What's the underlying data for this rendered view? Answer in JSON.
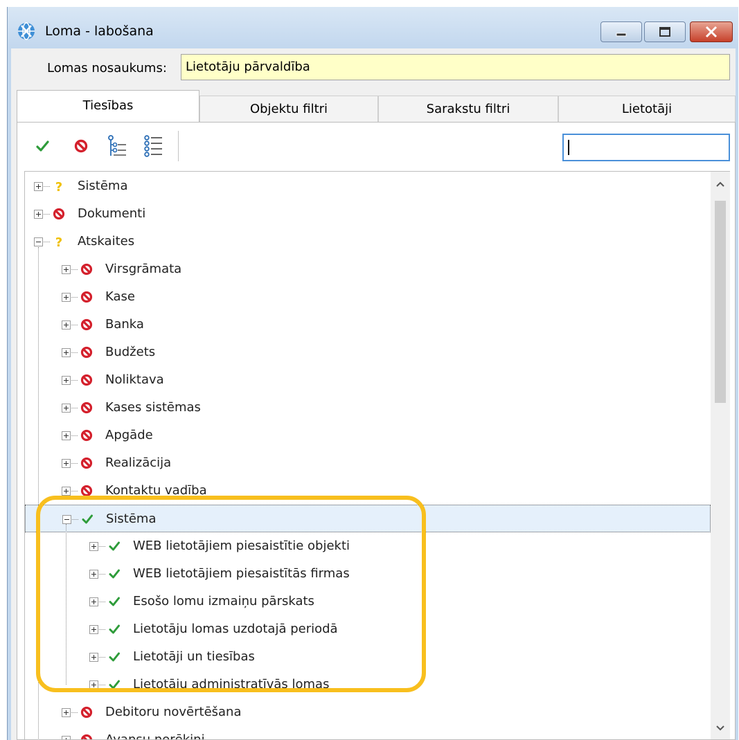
{
  "window": {
    "title": "Loma - labošana",
    "icons": {
      "app": "globe-icon",
      "minimize": "minimize-icon",
      "maximize": "maximize-icon",
      "close": "close-icon"
    }
  },
  "form": {
    "name_label": "Lomas nosaukums:",
    "name_value": "Lietotāju pārvaldība"
  },
  "tabs": [
    {
      "label": "Tiesības",
      "active": true
    },
    {
      "label": "Objektu filtri",
      "active": false
    },
    {
      "label": "Sarakstu filtri",
      "active": false
    },
    {
      "label": "Lietotāji",
      "active": false
    }
  ],
  "toolbar": {
    "buttons": [
      "allow-all-icon",
      "deny-all-icon",
      "expand-tree-icon",
      "collapse-list-icon"
    ],
    "search_value": ""
  },
  "tree": [
    {
      "label": "Sistēma",
      "status": "partial",
      "expanded": false
    },
    {
      "label": "Dokumenti",
      "status": "deny",
      "expanded": false
    },
    {
      "label": "Atskaites",
      "status": "partial",
      "expanded": true,
      "children": [
        {
          "label": "Virsgrāmata",
          "status": "deny",
          "expanded": false
        },
        {
          "label": "Kase",
          "status": "deny",
          "expanded": false
        },
        {
          "label": "Banka",
          "status": "deny",
          "expanded": false
        },
        {
          "label": "Budžets",
          "status": "deny",
          "expanded": false
        },
        {
          "label": "Noliktava",
          "status": "deny",
          "expanded": false
        },
        {
          "label": "Kases sistēmas",
          "status": "deny",
          "expanded": false
        },
        {
          "label": "Apgāde",
          "status": "deny",
          "expanded": false
        },
        {
          "label": "Realizācija",
          "status": "deny",
          "expanded": false
        },
        {
          "label": "Kontaktu vadība",
          "status": "deny",
          "expanded": false
        },
        {
          "label": "Sistēma",
          "status": "allow",
          "expanded": true,
          "selected": true,
          "children": [
            {
              "label": "WEB lietotājiem piesaistītie objekti",
              "status": "allow",
              "expanded": false
            },
            {
              "label": "WEB lietotājiem piesaistītās firmas",
              "status": "allow",
              "expanded": false
            },
            {
              "label": "Esošo lomu izmaiņu pārskats",
              "status": "allow",
              "expanded": false
            },
            {
              "label": "Lietotāju lomas uzdotajā periodā",
              "status": "allow",
              "expanded": false
            },
            {
              "label": "Lietotāji un tiesības",
              "status": "allow",
              "expanded": false
            },
            {
              "label": "Lietotāju administratīvās lomas",
              "status": "allow",
              "expanded": false
            }
          ]
        },
        {
          "label": "Debitoru novērtēšana",
          "status": "deny",
          "expanded": false
        },
        {
          "label": "Avansu norēķini",
          "status": "deny",
          "expanded": false
        }
      ]
    }
  ],
  "status_icons": {
    "allow": "check-icon",
    "deny": "no-entry-icon",
    "partial": "question-icon"
  },
  "colors": {
    "allow": "#2e9c3a",
    "deny": "#d4202c",
    "partial": "#f0c000",
    "highlight": "#f8bf1e",
    "name_field_bg": "#ffffc8",
    "search_border": "#4a90d9"
  }
}
